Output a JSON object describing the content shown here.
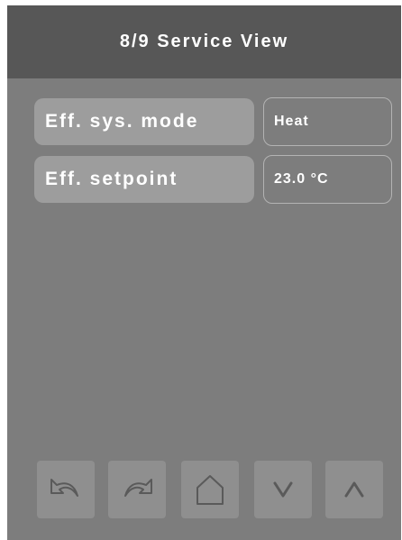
{
  "header": {
    "title": "8/9 Service View"
  },
  "rows": [
    {
      "label": "Eff. sys. mode",
      "value": "Heat"
    },
    {
      "label": "Eff. setpoint",
      "value": "23.0 °C"
    }
  ],
  "nav": [
    {
      "icon": "undo-arrow-icon"
    },
    {
      "icon": "redo-arrow-icon"
    },
    {
      "icon": "home-icon"
    },
    {
      "icon": "chevron-down-icon"
    },
    {
      "icon": "chevron-up-icon"
    }
  ],
  "colors": {
    "background": "#7d7d7d",
    "header": "#575757",
    "label_pill": "#9d9d9d",
    "button": "#8f8f8f",
    "icon": "#5a5a5a"
  }
}
